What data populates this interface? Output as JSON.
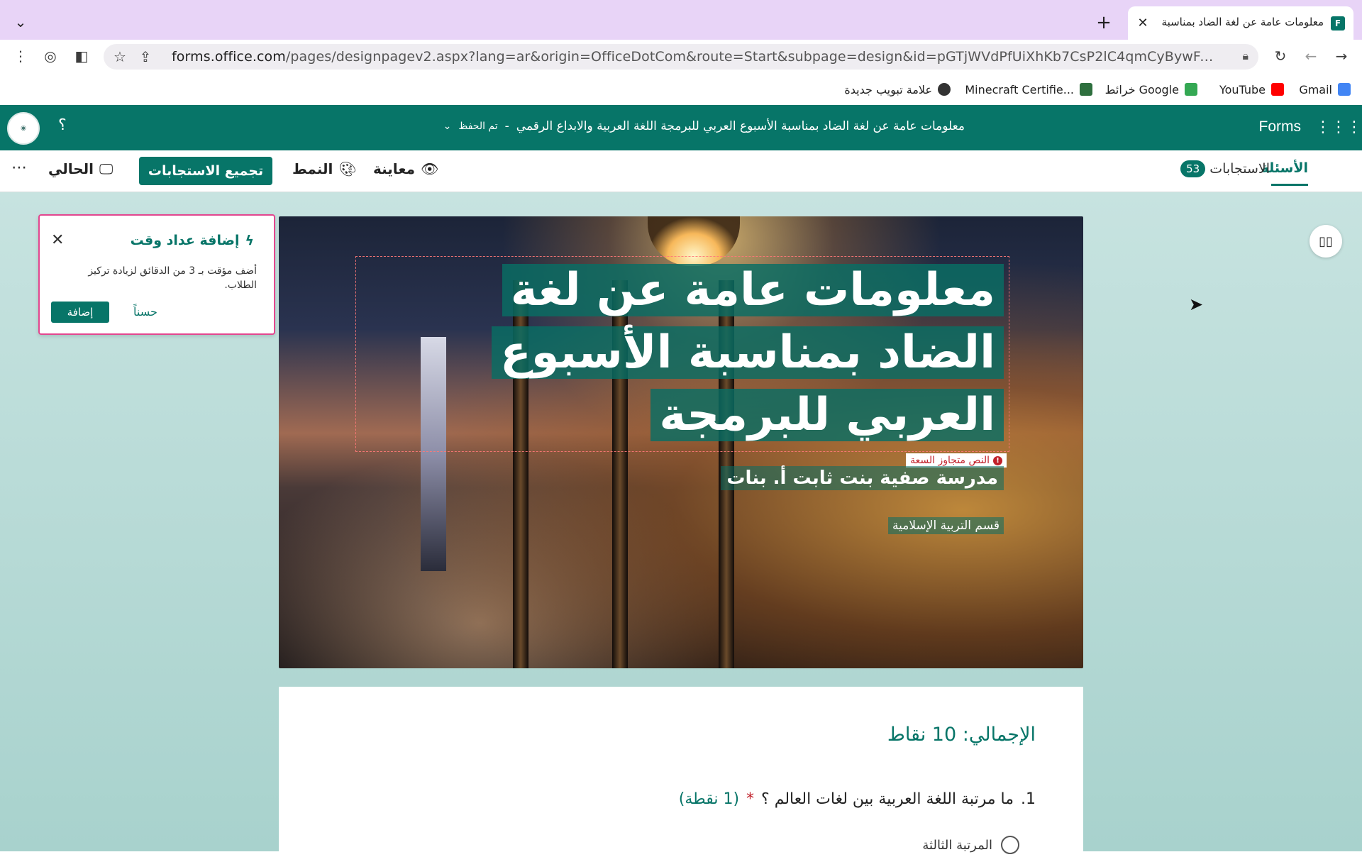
{
  "browser": {
    "tab_title": "معلومات عامة عن لغة الضاد  بمناسبة الأسبوع العربي",
    "tab_favicon_letter": "F",
    "url_host": "forms.office.com",
    "url_path": "/pages/designpagev2.aspx?lang=ar&origin=OfficeDotCom&route=Start&subpage=design&id=pGTjWVdPfUiXhKb7CsP2lC4qmCyBywFAoK-Q45e7GKh...",
    "bookmarks": [
      {
        "label": "Gmail",
        "icon": "gmail-icon",
        "color": "#4285f4"
      },
      {
        "label": "YouTube",
        "icon": "youtube-icon",
        "color": "#ff0000"
      },
      {
        "label": "خرائط Google",
        "icon": "maps-icon",
        "color": "#34a853"
      },
      {
        "label": "Minecraft Certifie...",
        "icon": "minecraft-icon",
        "color": "#2e6f3e"
      },
      {
        "label": "علامة تبويب جديدة",
        "icon": "globe-icon",
        "color": "#333333"
      }
    ]
  },
  "forms_header": {
    "app_name": "Forms",
    "form_title": "معلومات عامة عن لغة الضاد  بمناسبة الأسبوع العربي للبرمجة اللغة العربية والابداع الرقمي",
    "save_status": "تم الحفظ",
    "separator": "-"
  },
  "command_bar": {
    "questions_tab": "الأسئلة",
    "responses_tab": "الاستجابات",
    "responses_count": "53",
    "preview_label": "معاينة",
    "style_label": "النمط",
    "collect_label": "تجميع الاستجابات",
    "present_label": "الحالي"
  },
  "banner": {
    "title": "معلومات عامة عن لغة الضاد بمناسبة الأسبوع العربي للبرمجة",
    "overflow_warning": "النص متجاوز السعة",
    "subtitle": "مدرسة صفية بنت ثابت أ. بنات",
    "description": "قسم التربية الإسلامية"
  },
  "timer_card": {
    "title": "إضافة عداد وقت",
    "body": "أضف مؤقت بـ 3 من الدقائق لزيادة تركيز الطلاب.",
    "add_label": "إضافة",
    "ok_label": "حسناً"
  },
  "question_card": {
    "total": "الإجمالي: 10 نقاط",
    "q1_number": "1.",
    "q1_text": "ما مرتبة اللغة العربية بين لغات العالم ؟",
    "q1_required": "*",
    "q1_points": "(1 نقطة)",
    "q1_option1": "المرتبة الثالثة"
  },
  "colors": {
    "accent": "#077568",
    "tab_strip": "#e8d4f7",
    "timer_border": "#e3468f",
    "warning": "#c0202a"
  }
}
